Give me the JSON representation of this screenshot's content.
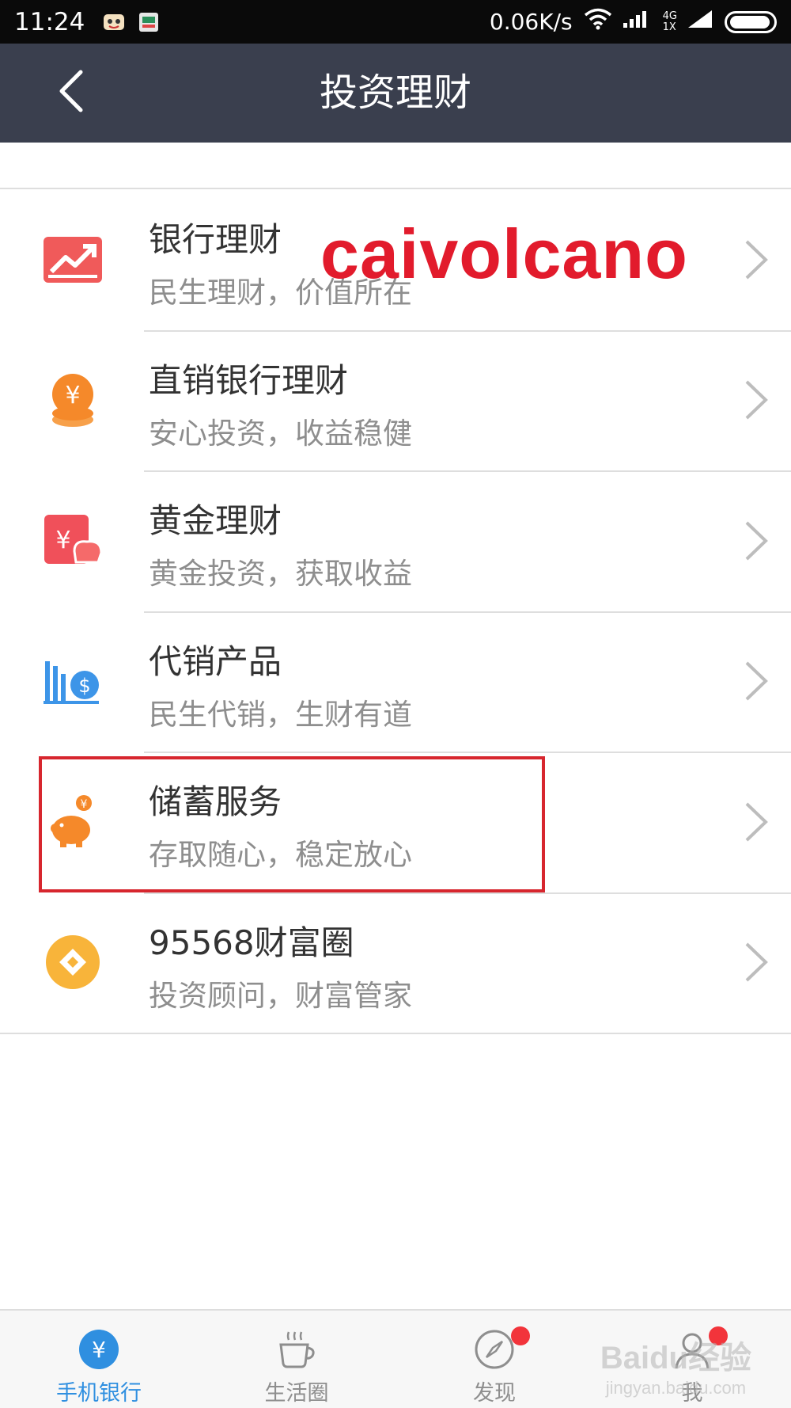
{
  "status_bar": {
    "time": "11:24",
    "network_speed": "0.06K/s",
    "network_type_top": "4G",
    "network_type_bottom": "1X"
  },
  "header": {
    "title": "投资理财",
    "back_icon": "chevron-left-icon"
  },
  "watermark": "caivolcano",
  "list": [
    {
      "title": "银行理财",
      "subtitle": "民生理财，价值所在",
      "icon": "trend-chart-icon",
      "color": "#f05a5a"
    },
    {
      "title": "直销银行理财",
      "subtitle": "安心投资，收益稳健",
      "icon": "yuan-coin-stack-icon",
      "color": "#f5892a"
    },
    {
      "title": "黄金理财",
      "subtitle": "黄金投资，获取收益",
      "icon": "gold-ingot-icon",
      "color": "#f0505a"
    },
    {
      "title": "代销产品",
      "subtitle": "民生代销，生财有道",
      "icon": "bar-dollar-icon",
      "color": "#3d95e8"
    },
    {
      "title": "储蓄服务",
      "subtitle": "存取随心，稳定放心",
      "icon": "piggy-bank-icon",
      "color": "#f5892a"
    },
    {
      "title": "95568财富圈",
      "subtitle": "投资顾问，财富管家",
      "icon": "wealth-circle-icon",
      "color": "#f8b43a"
    }
  ],
  "tabs": [
    {
      "label": "手机银行",
      "icon": "yuan-circle-icon",
      "active": true
    },
    {
      "label": "生活圈",
      "icon": "coffee-cup-icon",
      "active": false
    },
    {
      "label": "发现",
      "icon": "compass-icon",
      "active": false,
      "badge": true
    },
    {
      "label": "我",
      "icon": "person-icon",
      "active": false,
      "badge": true
    }
  ],
  "baidu_watermark": {
    "line1": "Baidu经验",
    "line2": "jingyan.baidu.com"
  },
  "colors": {
    "header_bg": "#3a3f4e",
    "active_tab": "#2f8fe0",
    "highlight": "#d7262e",
    "watermark": "#e21b2c"
  }
}
